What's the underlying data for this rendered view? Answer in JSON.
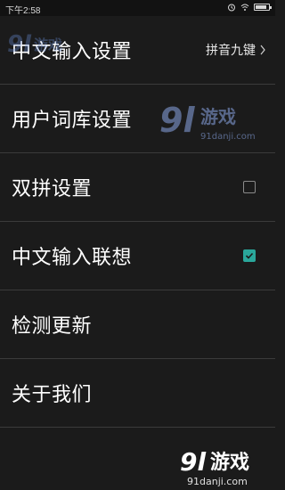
{
  "status_bar": {
    "time": "下午2:58",
    "icons": [
      "alarm-icon",
      "wifi-icon",
      "battery-icon"
    ],
    "battery_level_pct": 85
  },
  "settings": {
    "items": [
      {
        "label": "中文输入设置",
        "value": "拼音九键",
        "type": "link"
      },
      {
        "label": "用户词库设置",
        "type": "link"
      },
      {
        "label": "双拼设置",
        "type": "checkbox",
        "checked": false
      },
      {
        "label": "中文输入联想",
        "type": "checkbox",
        "checked": true
      },
      {
        "label": "检测更新",
        "type": "link"
      },
      {
        "label": "关于我们",
        "type": "link"
      }
    ]
  },
  "watermark": {
    "brand": "91游戏",
    "site": "91danji.com"
  },
  "colors": {
    "background": "#1b1b1b",
    "divider": "#3b3b3b",
    "accent": "#2aa79b"
  }
}
